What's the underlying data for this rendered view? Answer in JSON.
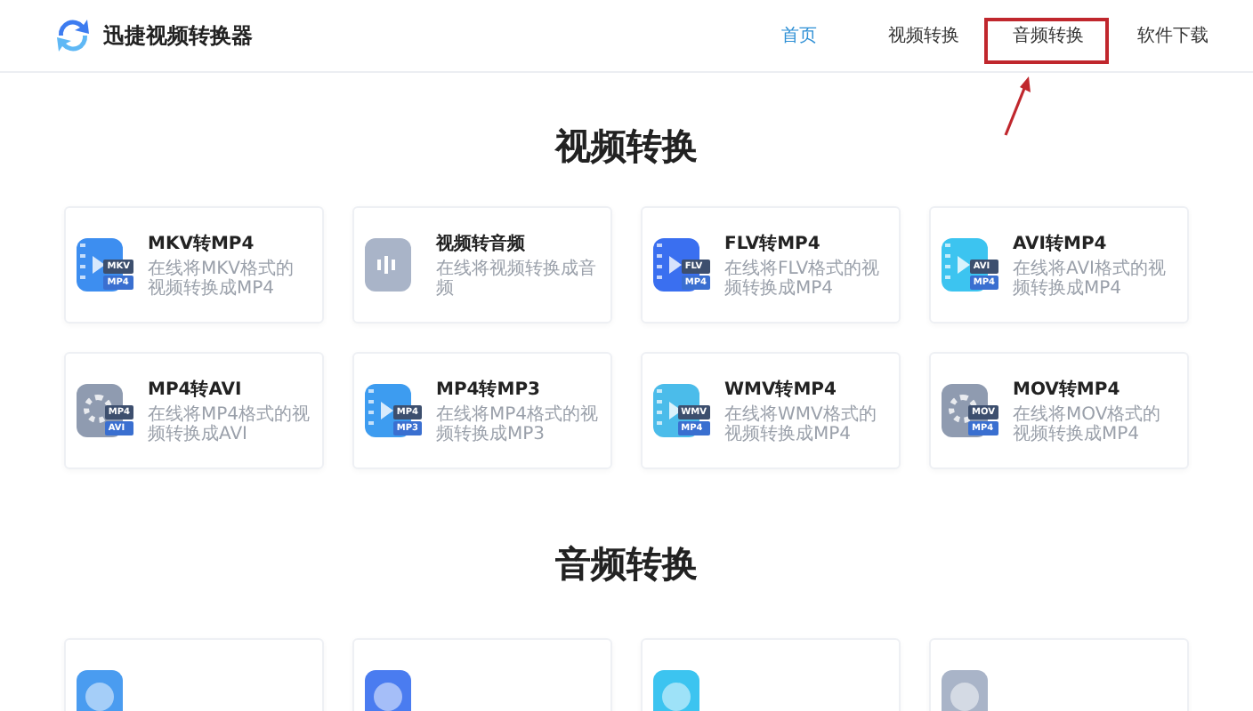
{
  "brand": {
    "name": "迅捷视频转换器"
  },
  "nav": [
    {
      "label": "首页",
      "selected": true
    },
    {
      "label": "视频转换",
      "selected": false
    },
    {
      "label": "音频转换",
      "selected": false
    },
    {
      "label": "软件下载",
      "selected": false
    }
  ],
  "sections": [
    {
      "title": "视频转换",
      "cards": [
        {
          "title": "MKV转MP4",
          "description": "在线将MKV格式的视频转换成MP4",
          "icon": {
            "kind": "film",
            "color": "#3d8ef0",
            "badges": [
              "MKV",
              "MP4"
            ]
          }
        },
        {
          "title": "视频转音频",
          "description": "在线将视频转换成音频",
          "icon": {
            "kind": "audio",
            "color": "#a9b4c8"
          }
        },
        {
          "title": "FLV转MP4",
          "description": "在线将FLV格式的视频转换成MP4",
          "icon": {
            "kind": "film",
            "color": "#3a6ff0",
            "badges": [
              "FLV",
              "MP4"
            ]
          }
        },
        {
          "title": "AVI转MP4",
          "description": "在线将AVI格式的视频转换成MP4",
          "icon": {
            "kind": "film",
            "color": "#3cc4f0",
            "badges": [
              "AVI",
              "MP4"
            ]
          }
        },
        {
          "title": "MP4转AVI",
          "description": "在线将MP4格式的视频转换成AVI",
          "icon": {
            "kind": "reel",
            "color": "#8f9bb0",
            "badges": [
              "MP4",
              "AVI"
            ]
          }
        },
        {
          "title": "MP4转MP3",
          "description": "在线将MP4格式的视频转换成MP3",
          "icon": {
            "kind": "film",
            "color": "#3d9cf0",
            "badges": [
              "MP4",
              "MP3"
            ]
          }
        },
        {
          "title": "WMV转MP4",
          "description": "在线将WMV格式的视频转换成MP4",
          "icon": {
            "kind": "film",
            "color": "#4bbcea",
            "badges": [
              "WMV",
              "MP4"
            ]
          }
        },
        {
          "title": "MOV转MP4",
          "description": "在线将MOV格式的视频转换成MP4",
          "icon": {
            "kind": "reel",
            "color": "#8f9bb0",
            "badges": [
              "MOV",
              "MP4"
            ]
          }
        }
      ]
    },
    {
      "title": "音频转换",
      "cards": [
        {
          "icon": {
            "kind": "disc",
            "color": "#4a9cf0"
          }
        },
        {
          "icon": {
            "kind": "disc",
            "color": "#4a7cf0"
          }
        },
        {
          "icon": {
            "kind": "disc",
            "color": "#3cc4f0"
          }
        },
        {
          "icon": {
            "kind": "disc",
            "color": "#a9b4c8"
          }
        }
      ]
    }
  ]
}
